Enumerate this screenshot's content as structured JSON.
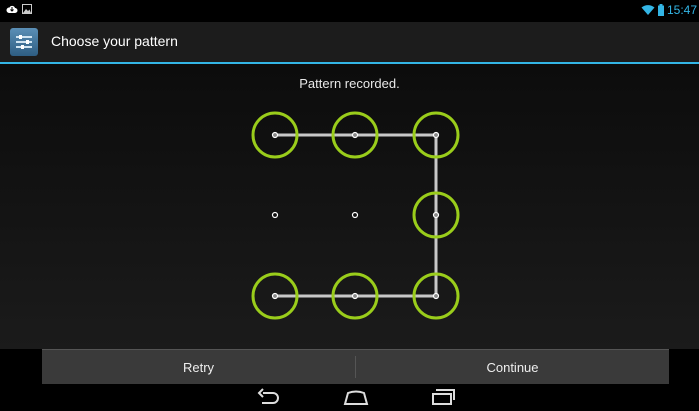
{
  "status_bar": {
    "time": "15:47",
    "left_icons": [
      "cloud-icon",
      "image-icon"
    ],
    "right_icons": [
      "wifi-icon",
      "battery-icon"
    ]
  },
  "action_bar": {
    "title": "Choose your pattern",
    "app_icon": "settings-icon"
  },
  "header": {
    "message": "Pattern recorded."
  },
  "pattern": {
    "grid": "3x3",
    "selected_dots": [
      0,
      1,
      2,
      5,
      8,
      7,
      6
    ],
    "unselected_dots": [
      3,
      4
    ],
    "path_order": [
      0,
      1,
      2,
      5,
      8,
      7,
      6
    ],
    "ring_color": "#9acd1b",
    "line_color": "#c8c8c8"
  },
  "buttons": {
    "retry_label": "Retry",
    "continue_label": "Continue"
  },
  "nav_bar": {
    "icons": [
      "back-icon",
      "home-icon",
      "recents-icon"
    ]
  },
  "colors": {
    "accent": "#33b5e5",
    "background": "#000000"
  }
}
